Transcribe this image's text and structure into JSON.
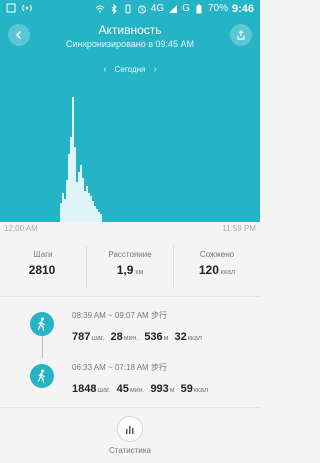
{
  "status_bar": {
    "network": "4G",
    "network_alt": "G",
    "battery": "70%",
    "time": "9:46"
  },
  "header": {
    "title": "Активность",
    "subtitle": "Синхронизировано в 09:45 AM",
    "date_label": "Сегодня"
  },
  "chart_data": {
    "type": "bar",
    "x": [
      60,
      62,
      64,
      66,
      68,
      70,
      72,
      74,
      76,
      78,
      80,
      82,
      84,
      86,
      88,
      90,
      92,
      94,
      96,
      98,
      100
    ],
    "values": [
      18,
      28,
      22,
      40,
      65,
      82,
      120,
      72,
      38,
      48,
      55,
      42,
      30,
      35,
      28,
      25,
      20,
      15,
      12,
      10,
      8
    ],
    "x_ticks": [
      "12:00 AM",
      "11:59 PM"
    ]
  },
  "stats": [
    {
      "label": "Шаги",
      "value": "2810",
      "unit": ""
    },
    {
      "label": "Расстояние",
      "value": "1,9",
      "unit": "км"
    },
    {
      "label": "Сожжено",
      "value": "120",
      "unit": "ккал"
    }
  ],
  "activities": [
    {
      "time": "08:39 AM ~ 09:07 AM 步行",
      "steps": "787",
      "steps_unit": "шаг.",
      "minutes": "28",
      "minutes_unit": "мин.",
      "distance": "536",
      "distance_unit": "м",
      "kcal": "32",
      "kcal_unit": "ккал"
    },
    {
      "time": "06:33 AM ~ 07:18 AM 步行",
      "steps": "1848",
      "steps_unit": "шаг.",
      "minutes": "45",
      "minutes_unit": "мин.",
      "distance": "993",
      "distance_unit": "м",
      "kcal": "59",
      "kcal_unit": "ккал"
    }
  ],
  "bottom": {
    "label": "Статистика"
  },
  "colors": {
    "accent": "#25b3c6"
  }
}
